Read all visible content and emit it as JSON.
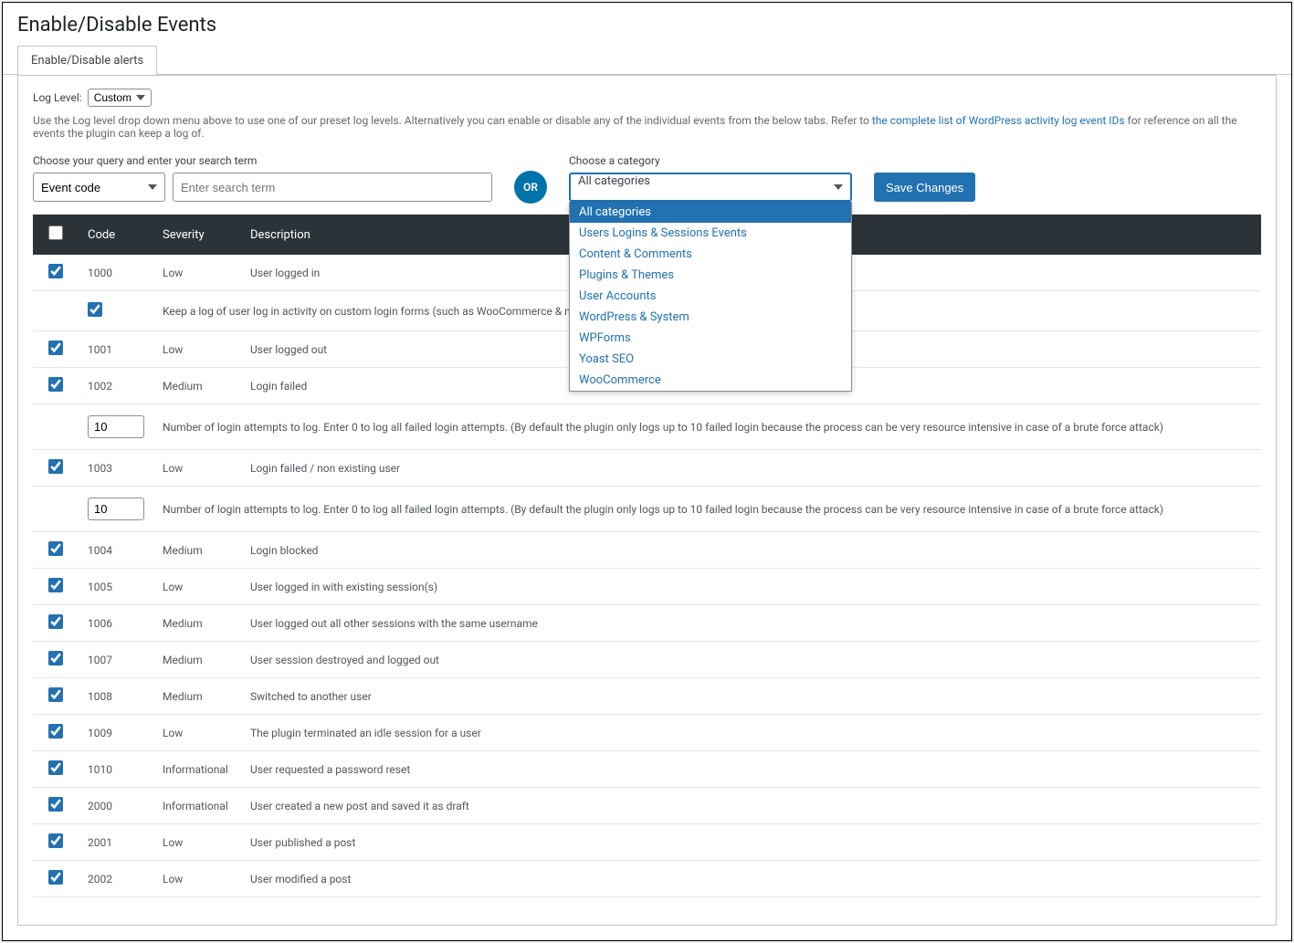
{
  "page": {
    "title": "Enable/Disable Events"
  },
  "tabs": {
    "alerts": "Enable/Disable alerts"
  },
  "loglevel": {
    "label": "Log Level:",
    "value": "Custom"
  },
  "help": {
    "prefix": "Use the Log level drop down menu above to use one of our preset log levels. Alternatively you can enable or disable any of the individual events from the below tabs. Refer to ",
    "link": "the complete list of WordPress activity log event IDs",
    "suffix": " for reference on all the events the plugin can keep a log of."
  },
  "query": {
    "label": "Choose your query and enter your search term",
    "code_select": "Event code",
    "placeholder": "Enter search term"
  },
  "or_label": "OR",
  "category": {
    "label": "Choose a category",
    "selected": "All categories",
    "options": [
      "All categories",
      "Users Logins & Sessions Events",
      "Content & Comments",
      "Plugins & Themes",
      "User Accounts",
      "WordPress & System",
      "WPForms",
      "Yoast SEO",
      "WooCommerce"
    ]
  },
  "save_label": "Save Changes",
  "table": {
    "headers": {
      "code": "Code",
      "severity": "Severity",
      "description": "Description"
    },
    "rows": [
      {
        "code": "1000",
        "severity": "Low",
        "desc": "User logged in"
      },
      {
        "sub": true,
        "check": true,
        "desc": "Keep a log of user log in activity on custom login forms (such as WooCommerce & membersh"
      },
      {
        "code": "1001",
        "severity": "Low",
        "desc": "User logged out"
      },
      {
        "code": "1002",
        "severity": "Medium",
        "desc": "Login failed"
      },
      {
        "sub": true,
        "input": "10",
        "desc": "Number of login attempts to log. Enter 0 to log all failed login attempts. (By default the plugin only logs up to 10 failed login because the process can be very resource intensive in case of a brute force attack)"
      },
      {
        "code": "1003",
        "severity": "Low",
        "desc": "Login failed / non existing user"
      },
      {
        "sub": true,
        "input": "10",
        "desc": "Number of login attempts to log. Enter 0 to log all failed login attempts. (By default the plugin only logs up to 10 failed login because the process can be very resource intensive in case of a brute force attack)"
      },
      {
        "code": "1004",
        "severity": "Medium",
        "desc": "Login blocked"
      },
      {
        "code": "1005",
        "severity": "Low",
        "desc": "User logged in with existing session(s)"
      },
      {
        "code": "1006",
        "severity": "Medium",
        "desc": "User logged out all other sessions with the same username"
      },
      {
        "code": "1007",
        "severity": "Medium",
        "desc": "User session destroyed and logged out"
      },
      {
        "code": "1008",
        "severity": "Medium",
        "desc": "Switched to another user"
      },
      {
        "code": "1009",
        "severity": "Low",
        "desc": "The plugin terminated an idle session for a user"
      },
      {
        "code": "1010",
        "severity": "Informational",
        "desc": "User requested a password reset"
      },
      {
        "code": "2000",
        "severity": "Informational",
        "desc": "User created a new post and saved it as draft"
      },
      {
        "code": "2001",
        "severity": "Low",
        "desc": "User published a post"
      },
      {
        "code": "2002",
        "severity": "Low",
        "desc": "User modified a post"
      }
    ]
  }
}
